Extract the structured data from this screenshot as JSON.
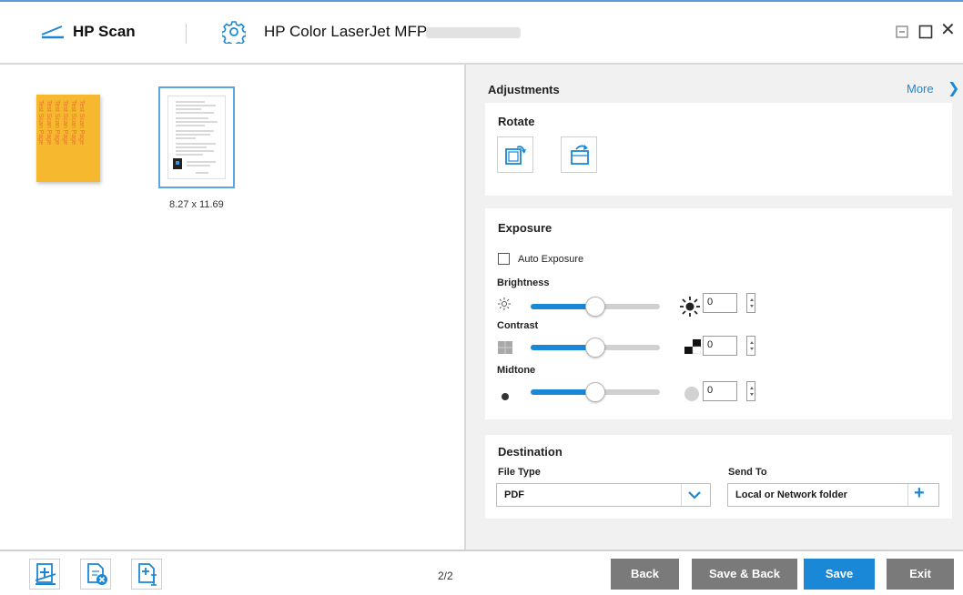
{
  "titlebar": {
    "app_name": "HP Scan",
    "device_name": "HP Color LaserJet MFP",
    "icons": {
      "app": "scanner-icon",
      "device": "gear-icon",
      "minimize": "minimize-icon",
      "maximize": "maximize-icon",
      "close": "close-icon"
    },
    "close_glyph": "✕"
  },
  "preview": {
    "thumbnails": [
      {
        "label": "",
        "selected": false,
        "text_lines": [
          "Test Scan Page",
          "Test Scan Page",
          "Test Scan Page",
          "Test Scan Page",
          "Test Scan Page",
          "Test Scan Page"
        ]
      },
      {
        "label": "8.27 x 11.69",
        "selected": true
      }
    ]
  },
  "adjustments": {
    "title": "Adjustments",
    "more_label": "More",
    "more_glyph": "❯"
  },
  "rotate": {
    "title": "Rotate",
    "buttons": [
      "rotate-right-icon",
      "rotate-left-icon"
    ]
  },
  "exposure": {
    "title": "Exposure",
    "auto_exposure_label": "Auto Exposure",
    "auto_exposure_checked": false,
    "sliders": [
      {
        "label": "Brightness",
        "value": "0",
        "fraction": 0.5,
        "low_icon": "sun-small-icon",
        "high_icon": "sun-large-icon"
      },
      {
        "label": "Contrast",
        "value": "0",
        "fraction": 0.5,
        "low_icon": "contrast-low-icon",
        "high_icon": "contrast-high-icon"
      },
      {
        "label": "Midtone",
        "value": "0",
        "fraction": 0.5,
        "low_icon": "midtone-dark-icon",
        "high_icon": "midtone-light-icon"
      }
    ]
  },
  "destination": {
    "title": "Destination",
    "file_type_label": "File Type",
    "file_type_value": "PDF",
    "send_to_label": "Send To",
    "send_to_value": "Local or Network folder",
    "add_glyph": "+"
  },
  "bottombar": {
    "tools": [
      "add-pages-icon",
      "delete-page-icon",
      "insert-page-icon"
    ],
    "page_counter": "2/2",
    "back_label": "Back",
    "save_back_label": "Save & Back",
    "save_label": "Save",
    "exit_label": "Exit"
  },
  "colors": {
    "accent": "#1a88d6",
    "grey_button": "#7a7a7a",
    "panel_bg": "#f1f1f1",
    "thumbnail_yellow": "#f5b82e",
    "thumbnail_text": "#e8752a"
  }
}
